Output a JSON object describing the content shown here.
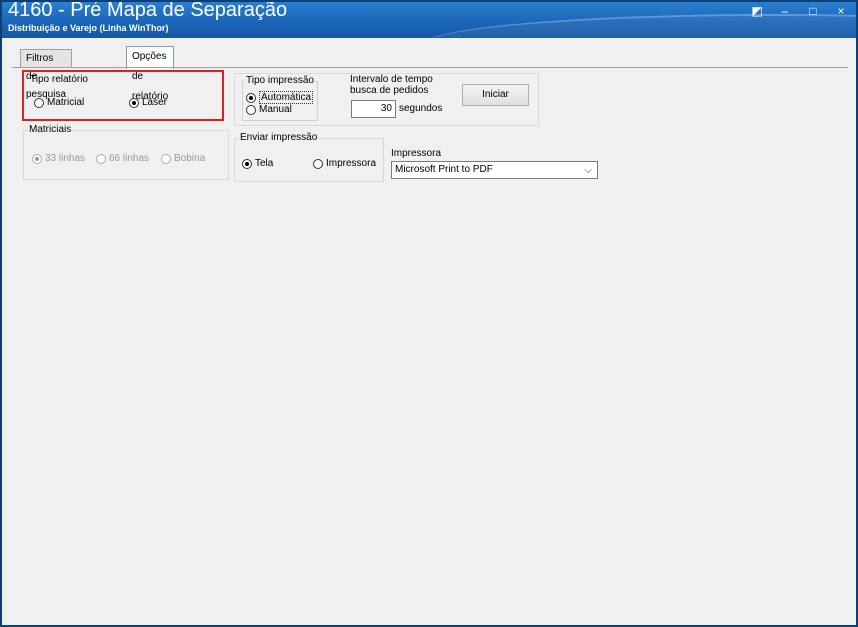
{
  "window": {
    "title": "4160 - Pré Mapa de Separação",
    "subtitle": "Distribuição e Varejo (Linha WinThor)",
    "controls": {
      "edit_icon": "◩",
      "minimize": "–",
      "maximize": "□",
      "close": "×"
    }
  },
  "tabs": [
    {
      "label": "Filtros de pesquisa",
      "active": false
    },
    {
      "label": "Opções de relatório",
      "active": true
    }
  ],
  "tipo_relatorio": {
    "label": "Tipo relatório",
    "options": [
      {
        "label": "Matricial",
        "selected": false
      },
      {
        "label": "Laser",
        "selected": true
      }
    ],
    "highlight_color": "#e02020"
  },
  "matriciais": {
    "label": "Matriciais",
    "options": [
      {
        "label": "33 linhas",
        "selected": true
      },
      {
        "label": "66 linhas",
        "selected": false
      },
      {
        "label": "Bobina",
        "selected": false
      }
    ]
  },
  "tipo_impressao": {
    "label": "Tipo impressão",
    "options": [
      {
        "label": "Automática",
        "selected": true
      },
      {
        "label": "Manual",
        "selected": false
      }
    ]
  },
  "intervalo": {
    "label_line1": "Intervalo de tempo",
    "label_line2": "busca de pedidos",
    "value": "30",
    "unit": "segundos",
    "start_button": "Iniciar"
  },
  "enviar_impressao": {
    "label": "Enviar impressão",
    "options": [
      {
        "label": "Tela",
        "selected": true
      },
      {
        "label": "Impressora",
        "selected": false
      }
    ]
  },
  "impressora": {
    "label": "Impressora",
    "value": "Microsoft Print to PDF",
    "dropdown_icon": "⌵"
  }
}
